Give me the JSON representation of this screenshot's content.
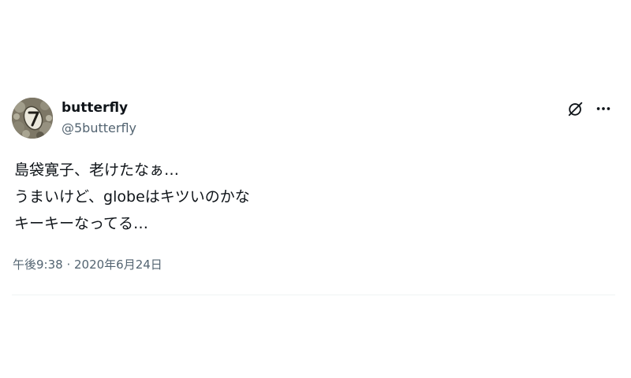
{
  "tweet": {
    "author": {
      "display_name": "butterfly",
      "handle": "@5butterfly",
      "avatar_icon": "avatar-photo-number-7"
    },
    "actions": {
      "grok_icon": "grok-icon",
      "more_icon": "more-horizontal-icon"
    },
    "text_lines": [
      "島袋寛子、老けたなぁ…",
      "うまいけど、globeはキツいのかな",
      "キーキーなってる…"
    ],
    "timestamp": "午後9:38 · 2020年6月24日"
  },
  "colors": {
    "text_primary": "#0f1419",
    "text_secondary": "#536471",
    "divider": "#eff3f4",
    "background": "#ffffff"
  }
}
